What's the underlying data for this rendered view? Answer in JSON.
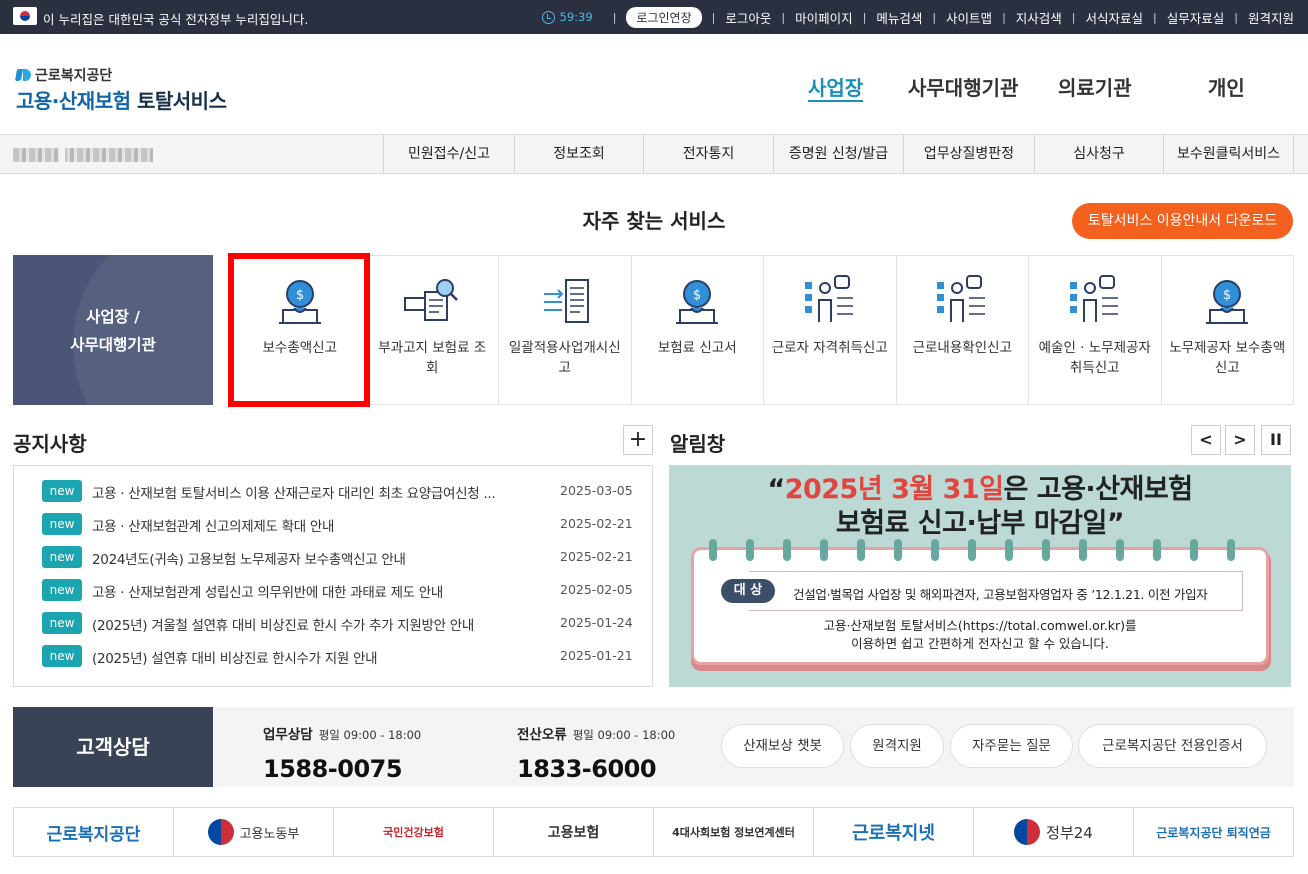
{
  "topbar": {
    "gov_notice": "이 누리집은 대한민국 공식 전자정부 누리집입니다.",
    "timer": "59:39",
    "extend_label": "로그인연장",
    "links": [
      "로그아웃",
      "마이페이지",
      "메뉴검색",
      "사이트맵",
      "지사검색",
      "서식자료실",
      "실무자료실",
      "원격지원"
    ]
  },
  "header": {
    "org_name": "근로복지공단",
    "service_name_a": "고용·산재보험",
    "service_name_b": "토탈서비스",
    "nav": [
      "사업장",
      "사무대행기관",
      "의료기관",
      "개인"
    ],
    "nav_active": "사업장"
  },
  "subnav": [
    "민원접수/신고",
    "정보조회",
    "전자통지",
    "증명원 신청/발급",
    "업무상질병판정",
    "심사청구",
    "보수원클릭서비스"
  ],
  "frequent": {
    "title": "자주 찾는 서비스",
    "guide_button": "토탈서비스 이용안내서 다운로드",
    "category_line1": "사업장 /",
    "category_line2": "사무대행기관",
    "items": [
      {
        "label": "보수총액신고",
        "icon": "money-bag-laptop-icon"
      },
      {
        "label": "부과고지 보험료 조회",
        "icon": "document-search-icon"
      },
      {
        "label": "일괄적용사업개시신고",
        "icon": "document-transfer-icon"
      },
      {
        "label": "보험료 신고서",
        "icon": "money-bag-laptop-icon"
      },
      {
        "label": "근로자 자격취득신고",
        "icon": "worker-chart-icon"
      },
      {
        "label": "근로내용확인신고",
        "icon": "worker-chart-icon"
      },
      {
        "label": "예술인 · 노무제공자 취득신고",
        "icon": "worker-chart-icon"
      },
      {
        "label": "노무제공자 보수총액신고",
        "icon": "money-bag-laptop-icon"
      }
    ]
  },
  "notices": {
    "title": "공지사항",
    "more": "+",
    "badge": "new",
    "items": [
      {
        "title": "고용 · 산재보험 토탈서비스 이용 산재근로자 대리인 최초 요양급여신청 ...",
        "date": "2025-03-05"
      },
      {
        "title": "고용 · 산재보험관계 신고의제제도 확대 안내",
        "date": "2025-02-21"
      },
      {
        "title": "2024년도(귀속) 고용보험 노무제공자 보수총액신고 안내",
        "date": "2025-02-21"
      },
      {
        "title": "고용 · 산재보험관계 성립신고 의무위반에 대한 과태료 제도 안내",
        "date": "2025-02-05"
      },
      {
        "title": "(2025년) 겨울철 설연휴 대비 비상진료 한시 수가 추가 지원방안 안내",
        "date": "2025-01-24"
      },
      {
        "title": "(2025년) 설연휴 대비 비상진료 한시수가 지원 안내",
        "date": "2025-01-21"
      }
    ]
  },
  "alert": {
    "title": "알림창",
    "headline_open": "“",
    "headline_red": "2025년 3월 31일",
    "headline_rest": "은 고용·산재보험",
    "headline_line2": "보험료 신고·납부 마감일”",
    "target_label": "대 상",
    "target_text": "건설업·벌목업 사업장 및 해외파견자, 고용보험자영업자 중 ’12.1.21. 이전 가입자",
    "footer_line1": "고용·산재보험 토탈서비스(https://total.comwel.or.kr)를",
    "footer_line2": "이용하면 쉽고 간편하게 전자신고 할 수 있습니다.",
    "prev": "<",
    "next": ">",
    "pause": "II"
  },
  "customer": {
    "title": "고객상담",
    "work_label": "업무상담",
    "work_hours": "평일 09:00 - 18:00",
    "work_phone": "1588-0075",
    "it_label": "전산오류",
    "it_hours": "평일 09:00 - 18:00",
    "it_phone": "1833-6000",
    "buttons": [
      "산재보상 챗봇",
      "원격지원",
      "자주묻는 질문",
      "근로복지공단 전용인증서"
    ]
  },
  "partners": [
    "근로복지공단",
    "고용노동부",
    "국민건강보험",
    "고용보험",
    "4대사회보험 정보연계센터",
    "근로복지넷",
    "정부24",
    "근로복지공단 퇴직연금"
  ],
  "colors": {
    "accent": "#1a8fb9",
    "orange": "#f4611f",
    "teal_badge": "#1ba5b0",
    "navy": "#3a4256",
    "highlight": "#ff0000"
  }
}
